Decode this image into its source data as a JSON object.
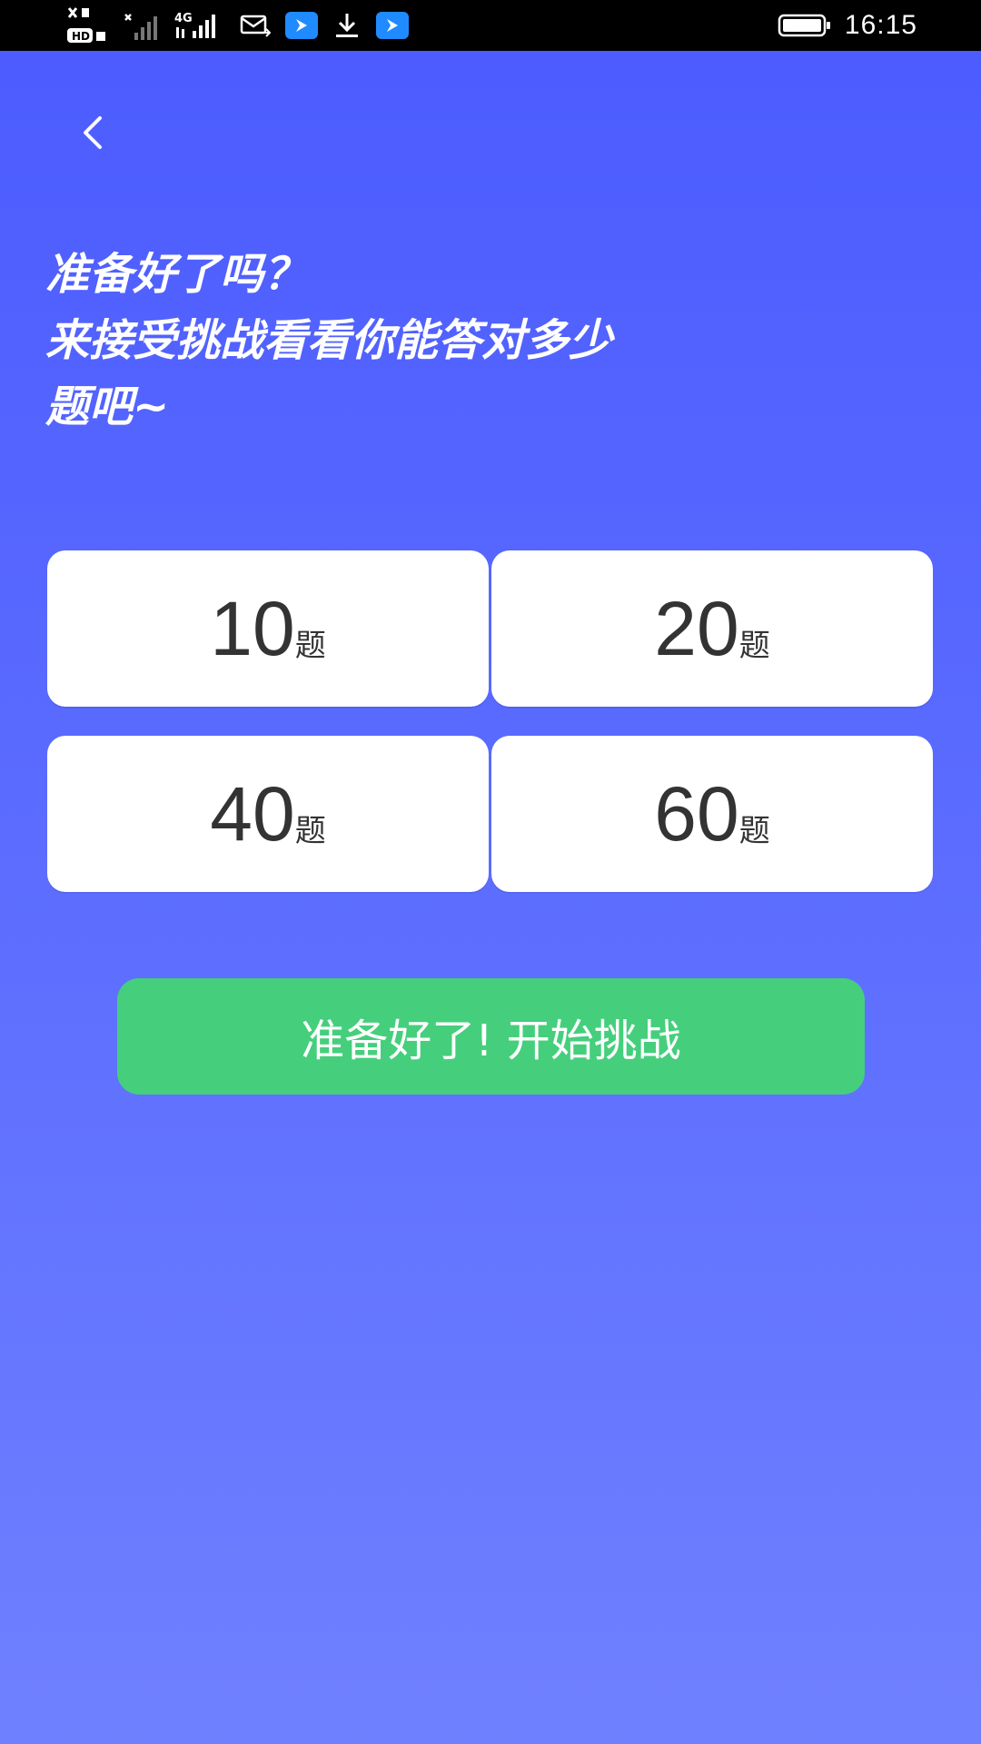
{
  "status_bar": {
    "time": "16:15",
    "icons": [
      "hd-call-icon",
      "signal-weak-icon",
      "signal-4g-icon",
      "mail-icon",
      "app-notification-icon",
      "download-icon",
      "app-notification-icon",
      "battery-icon"
    ]
  },
  "header": {
    "back_icon": "chevron-left-icon"
  },
  "headline": {
    "line1": "准备好了吗？",
    "line2": "来接受挑战看看你能答对多少",
    "line3": "题吧~"
  },
  "options": [
    {
      "number": "10",
      "unit": "题"
    },
    {
      "number": "20",
      "unit": "题"
    },
    {
      "number": "40",
      "unit": "题"
    },
    {
      "number": "60",
      "unit": "题"
    }
  ],
  "start_button": {
    "label": "准备好了! 开始挑战"
  },
  "colors": {
    "background_top": "#4b5bff",
    "background_bottom": "#6f80ff",
    "option_bg": "#ffffff",
    "start_button": "#45cf7c",
    "text_dark": "#333333"
  }
}
